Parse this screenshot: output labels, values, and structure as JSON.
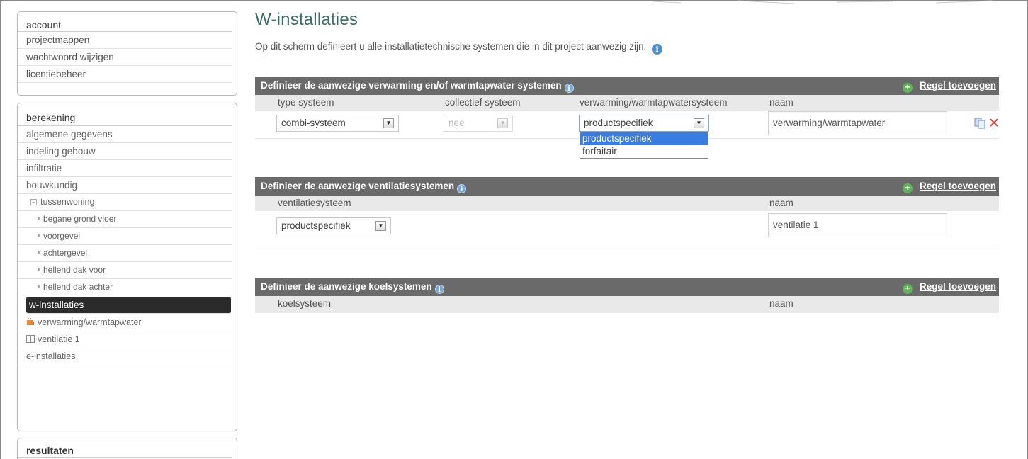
{
  "sidebar": {
    "account": {
      "title": "account",
      "items": [
        "projectmappen",
        "wachtwoord wijzigen",
        "licentiebeheer"
      ]
    },
    "berekening": {
      "title": "berekening",
      "items": [
        "algemene gegevens",
        "indeling gebouw",
        "infiltratie",
        "bouwkundig"
      ],
      "tree_root": "tussenwoning",
      "tree_children": [
        "begane grond vloer",
        "voorgevel",
        "achtergevel",
        "hellend dak voor",
        "hellend dak achter"
      ],
      "active_item": "w-installaties",
      "systems": [
        "verwarming/warmtapwater",
        "ventilatie 1"
      ],
      "last_item": "e-installaties"
    },
    "resultaten": {
      "title": "resultaten"
    }
  },
  "main": {
    "title": "W-installaties",
    "intro": "Op dit scherm definieert u alle installatietechnische systemen die in dit project aanwezig zijn.",
    "info_glyph": "i",
    "add_glyph": "+",
    "add_label": "Regel toevoegen",
    "heating": {
      "header": "Definieer de aanwezige verwarming en/of warmtapwater systemen",
      "columns": [
        "type systeem",
        "collectief systeem",
        "verwarming/warmtapwatersysteem",
        "naam"
      ],
      "row": {
        "type_systeem": "combi-systeem",
        "collectief": "nee",
        "systeem": "productspecifiek",
        "naam": "verwarming/warmtapwater"
      },
      "dropdown_options": [
        "productspecifiek",
        "forfaitair"
      ]
    },
    "ventilation": {
      "header": "Definieer de aanwezige ventilatiesystemen",
      "columns": [
        "ventilatiesysteem",
        "naam"
      ],
      "row": {
        "systeem": "productspecifiek",
        "naam": "ventilatie 1"
      }
    },
    "cooling": {
      "header": "Definieer de aanwezige koelsystemen",
      "columns": [
        "koelsysteem",
        "naam"
      ]
    }
  },
  "glyphs": {
    "arrow": "▼",
    "delete": "✕",
    "tree_collapse": "−"
  },
  "colors": {
    "title": "#3a6f5c",
    "header_bg": "#6a6a6a",
    "active_bg": "#2b2b2b",
    "add_icon": "#62b35a",
    "delete": "#d03a32",
    "selection": "#3a7de0"
  }
}
